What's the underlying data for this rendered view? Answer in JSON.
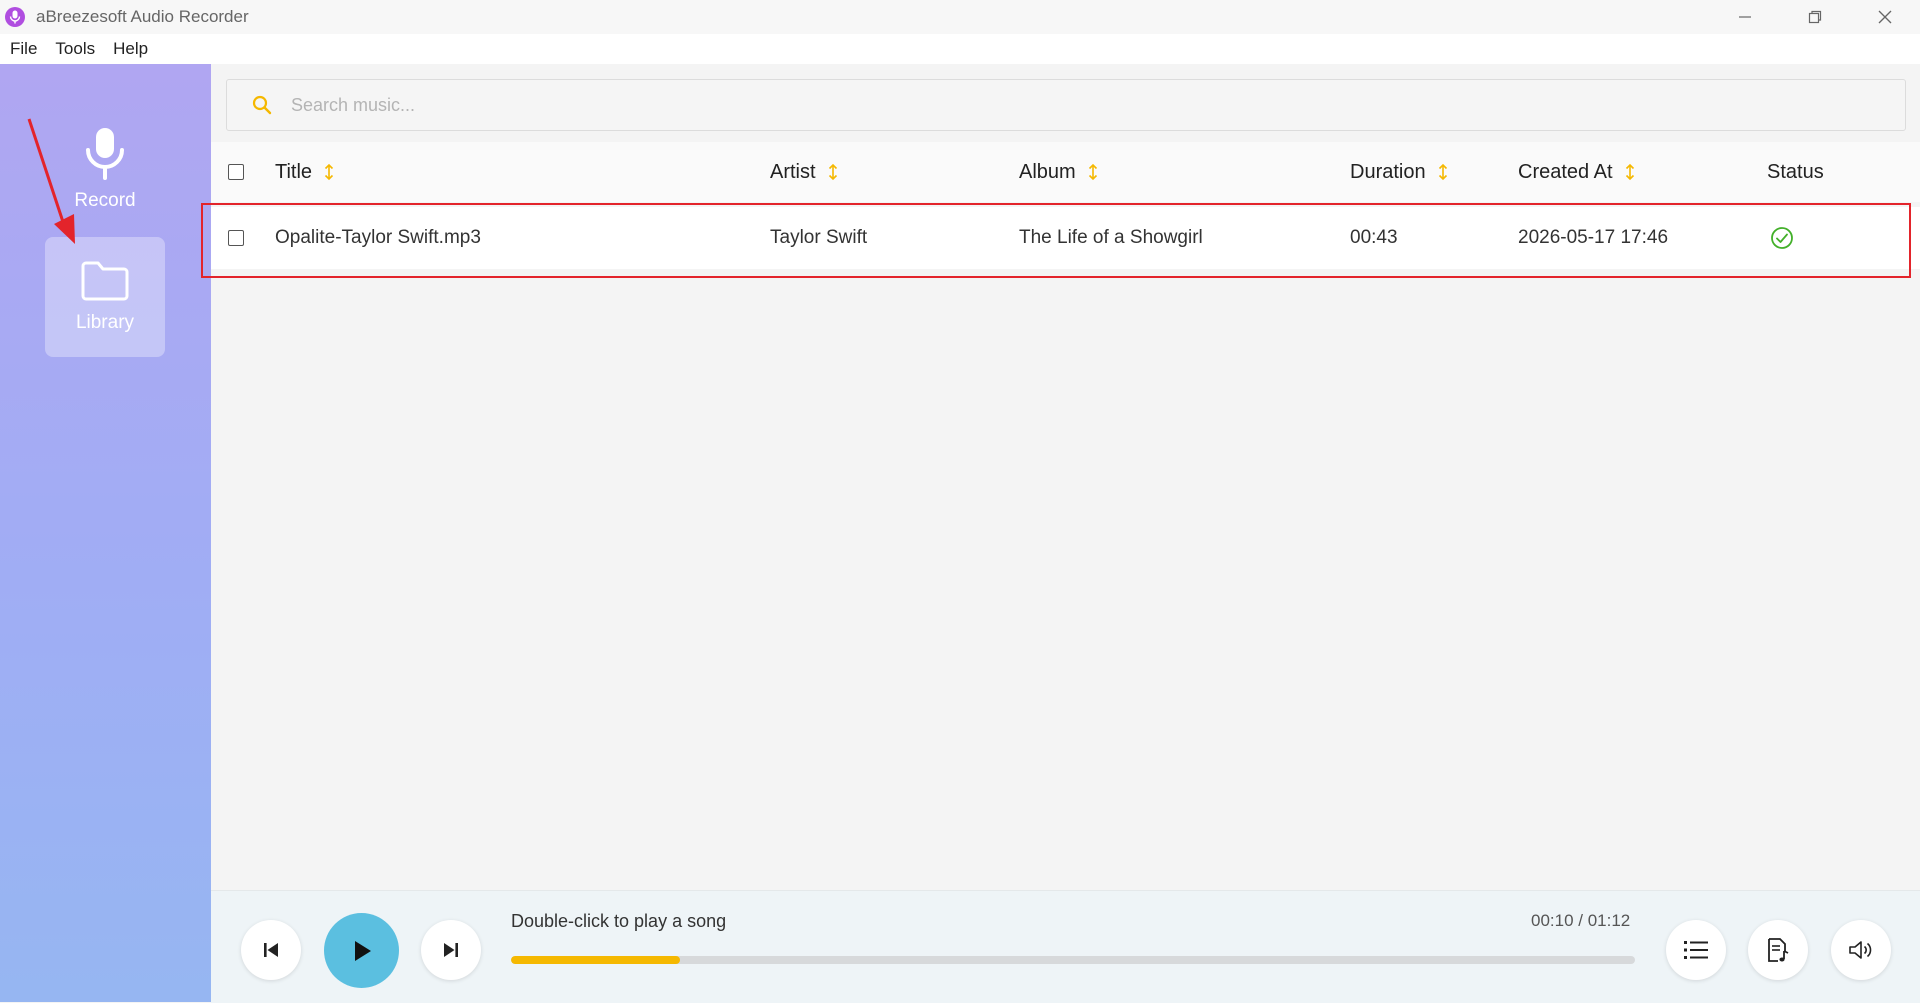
{
  "window": {
    "title": "aBreezesoft Audio Recorder"
  },
  "menu": {
    "items": [
      "File",
      "Tools",
      "Help"
    ]
  },
  "sidebar": {
    "items": [
      {
        "label": "Record",
        "icon": "microphone-icon",
        "active": false
      },
      {
        "label": "Library",
        "icon": "folder-icon",
        "active": true
      }
    ]
  },
  "search": {
    "placeholder": "Search music...",
    "value": ""
  },
  "table": {
    "columns": [
      "Title",
      "Artist",
      "Album",
      "Duration",
      "Created At",
      "Status"
    ],
    "rows": [
      {
        "title": "Opalite-Taylor Swift.mp3",
        "artist": "Taylor Swift",
        "album": "The Life of a Showgirl",
        "duration": "00:43",
        "created_at": "2026-05-17 17:46",
        "status": "check-circle-icon"
      }
    ]
  },
  "player": {
    "now_playing": "Double-click to play a song",
    "time": "00:10 / 01:12",
    "progress": 0.15
  },
  "colors": {
    "accent": "#f5b800",
    "play_button": "#5bbfe0",
    "status_ok": "#43b02a",
    "highlight": "#e3242b",
    "sidebar_top": "#b0a6f2",
    "sidebar_bottom": "#96b6f2"
  }
}
